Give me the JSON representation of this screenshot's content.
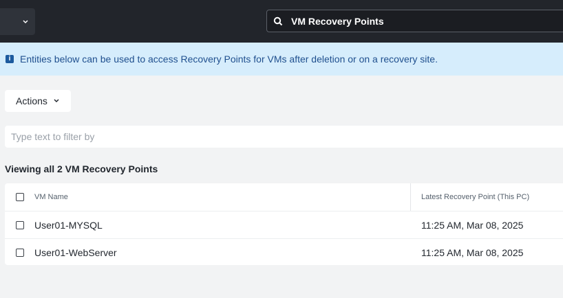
{
  "search": {
    "value": "VM Recovery Points"
  },
  "banner": {
    "message": "Entities below can be used to access Recovery Points for VMs after deletion or on a recovery site."
  },
  "toolbar": {
    "actions_label": "Actions"
  },
  "filter": {
    "placeholder": "Type text to filter by"
  },
  "summary": {
    "text": "Viewing all 2 VM Recovery Points"
  },
  "table": {
    "columns": [
      "VM Name",
      "Latest Recovery Point (This PC)"
    ],
    "rows": [
      {
        "name": "User01-MYSQL",
        "latest": "11:25 AM, Mar 08, 2025"
      },
      {
        "name": "User01-WebServer",
        "latest": "11:25 AM, Mar 08, 2025"
      }
    ]
  },
  "colors": {
    "topbar": "#22252b",
    "banner_bg": "#d6edfc",
    "banner_text": "#1f4f8e"
  },
  "icons": [
    "chevron-down-icon",
    "search-icon",
    "info-icon",
    "checkbox"
  ]
}
